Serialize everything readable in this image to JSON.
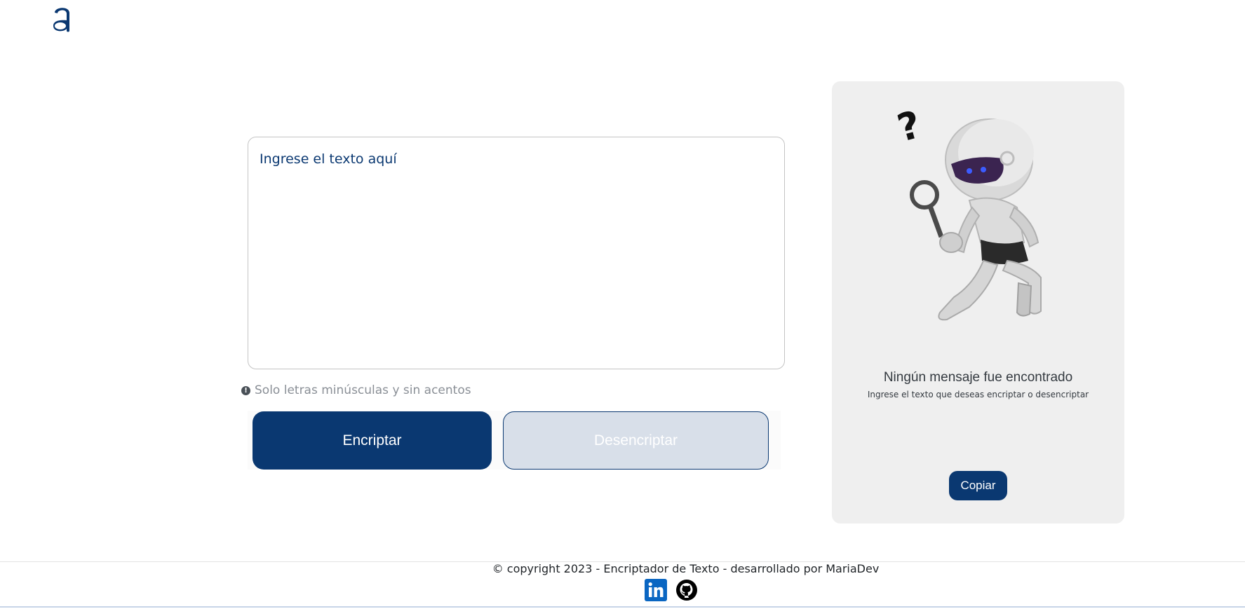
{
  "logo": {
    "icon": "alura-logo-icon"
  },
  "input": {
    "placeholder": "Ingrese el texto aquí",
    "value": ""
  },
  "hint": {
    "icon": "exclamation-circle-icon",
    "text": "Solo letras minúsculas y sin acentos"
  },
  "buttons": {
    "encrypt": "Encriptar",
    "decrypt": "Desencriptar"
  },
  "panel": {
    "image": "robot-with-magnifier-image",
    "title": "Ningún mensaje fue encontrado",
    "subtitle": "Ingrese el texto que deseas encriptar o desencriptar",
    "copy_label": "Copiar"
  },
  "footer": {
    "text": "© copyright 2023 - Encriptador de Texto - desarrollado por MariaDev",
    "links": [
      {
        "icon": "linkedin-icon",
        "color": "#0a66c2"
      },
      {
        "icon": "github-icon",
        "color": "#000000"
      }
    ]
  },
  "colors": {
    "primary": "#0a3871",
    "panel_bg": "#efefef",
    "secondary_btn": "#d8dfe9"
  }
}
